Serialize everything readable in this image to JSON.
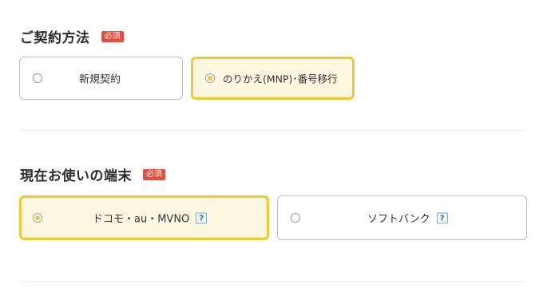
{
  "contract": {
    "title": "ご契約方法",
    "required_badge": "必須",
    "options": [
      {
        "label": "新規契約",
        "selected": false
      },
      {
        "label": "のりかえ(MNP)･番号移行",
        "selected": true
      }
    ]
  },
  "device": {
    "title": "現在お使いの端末",
    "required_badge": "必須",
    "options": [
      {
        "label": "ドコモ・au・MVNO",
        "help": "?",
        "selected": true
      },
      {
        "label": "ソフトバンク",
        "help": "?",
        "selected": false
      }
    ]
  },
  "colors": {
    "accent_border": "#f0c930",
    "selected_bg": "#fdf7e2",
    "badge_bg": "#e74c3c",
    "help_icon": "#1d6fb0"
  },
  "icons": {
    "radio": "radio-icon",
    "help": "help-question-icon"
  }
}
